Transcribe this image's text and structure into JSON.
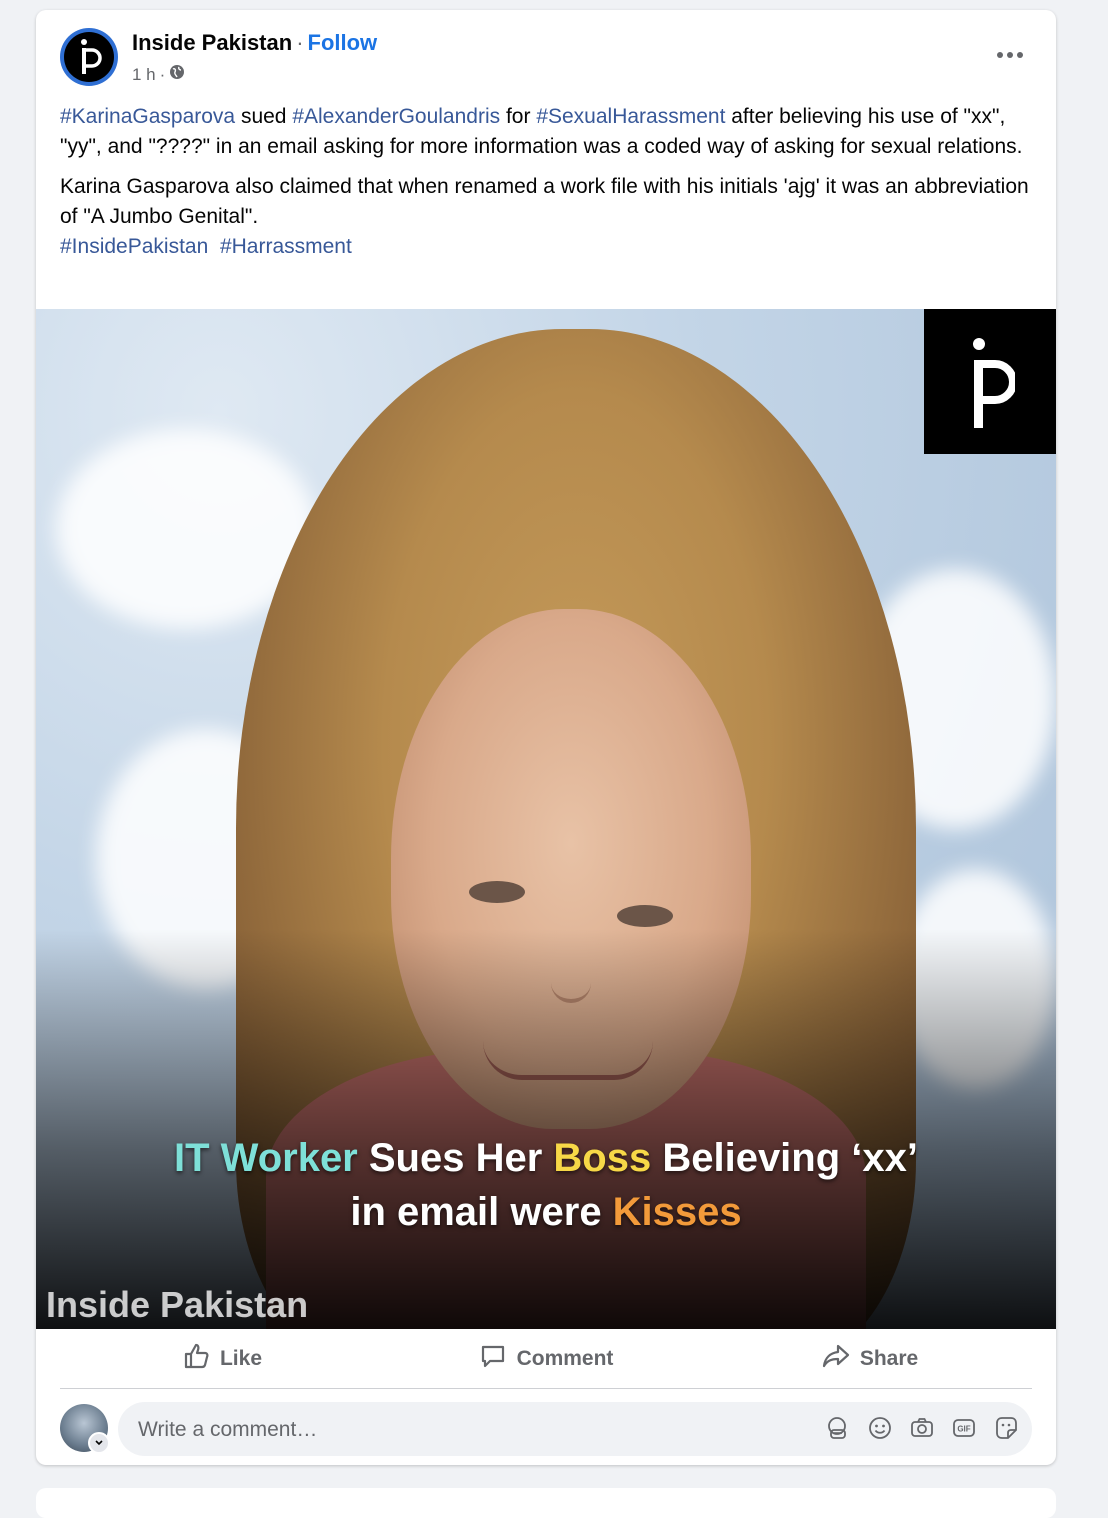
{
  "post": {
    "page_name": "Inside Pakistan",
    "separator": "·",
    "follow_label": "Follow",
    "time": "1 h",
    "time_dot": "·",
    "text": {
      "p1": {
        "tag1": "#KarinaGasparova",
        "w1": " sued ",
        "tag2": "#AlexanderGoulandris",
        "w2": " for ",
        "tag3": "#SexualHarassment",
        "w3": " after believing his use of \"xx\", \"yy\", and \"????\" in an email asking for more information was a coded way of asking for sexual relations."
      },
      "p2": {
        "line": "Karina Gasparova also claimed that when  renamed a work file with his initials 'ajg' it was an abbreviation of \"A Jumbo Genital\".",
        "tag4": "#InsidePakistan",
        "tag5": "#Harrassment"
      }
    },
    "media": {
      "caption_line1": {
        "a": "IT Worker",
        "b": " Sues Her ",
        "c": "Boss",
        "d": " Believing ‘xx’"
      },
      "caption_line2": {
        "a": "in email were ",
        "b": "Kisses"
      },
      "watermark": "Inside Pakistan"
    },
    "actions": {
      "like": "Like",
      "comment": "Comment",
      "share": "Share"
    },
    "comment_input": {
      "placeholder": "Write a comment…"
    }
  },
  "colors": {
    "link": "#385898",
    "follow": "#1b74e4",
    "muted": "#65676b"
  },
  "icons": [
    "more-options-icon",
    "globe-icon",
    "like-icon",
    "comment-icon",
    "share-icon",
    "avatar-sticker-icon",
    "emoji-icon",
    "camera-icon",
    "gif-icon",
    "sticker-icon"
  ]
}
